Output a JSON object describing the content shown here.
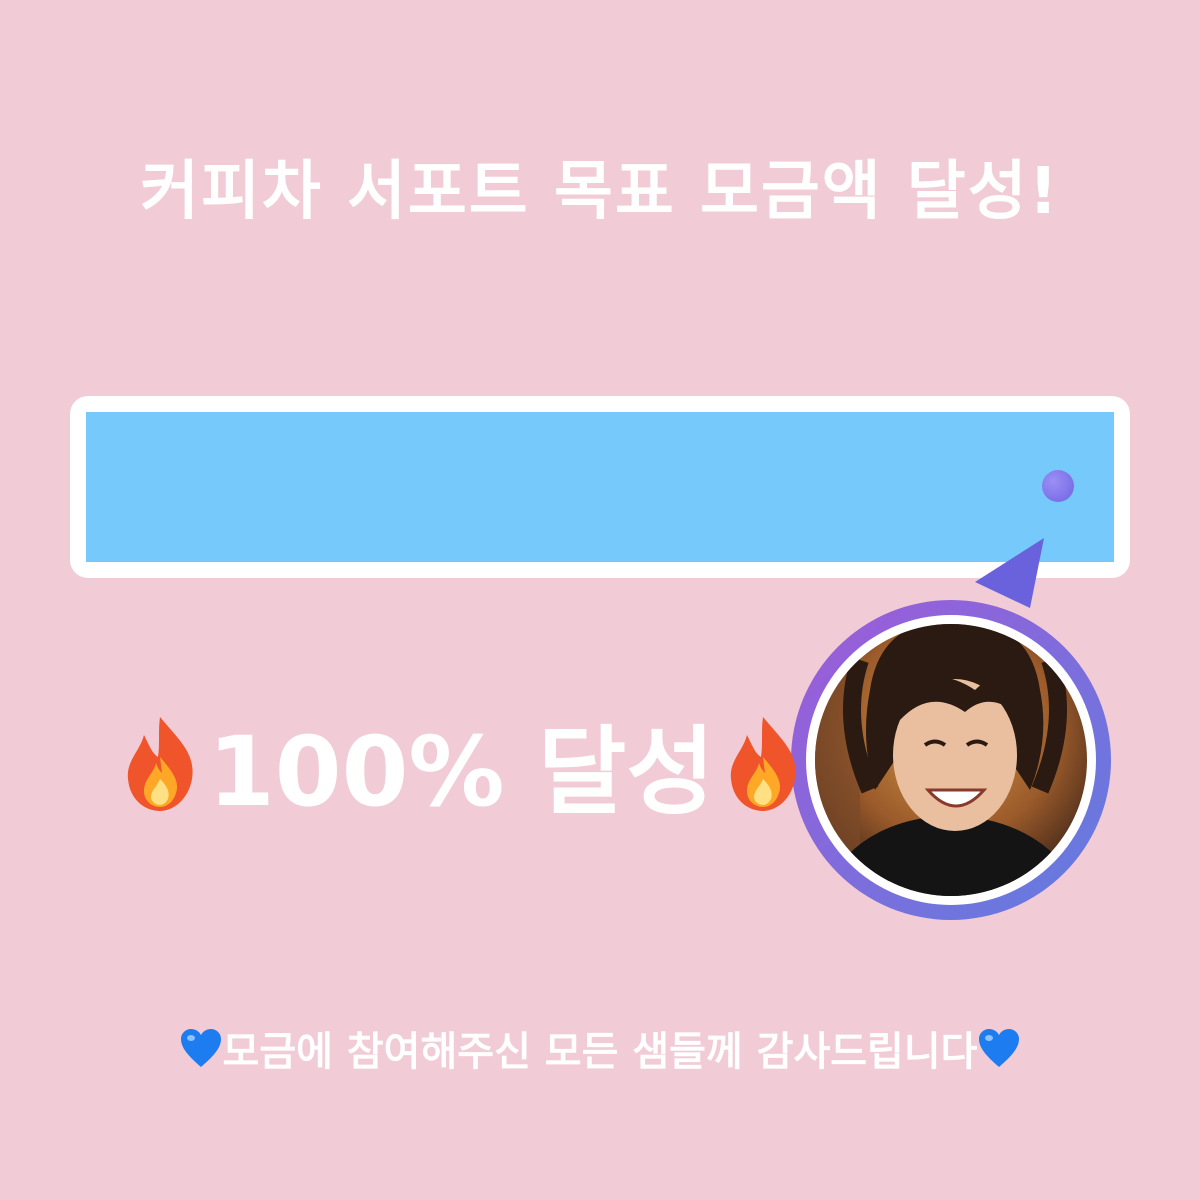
{
  "header": {
    "title": "커피차 서포트 목표 모금액 달성!"
  },
  "progress": {
    "percent": 100,
    "fill_color": "#76c9fb"
  },
  "result": {
    "label": "100% 달성",
    "icon": "fire-icon"
  },
  "avatar": {
    "ring_colors": [
      "#a05ad8",
      "#5f7ee0"
    ]
  },
  "footer": {
    "thanks": "모금에 참여해주신 모든 샘들께 감사드립니다",
    "icon": "blue-heart-icon"
  }
}
